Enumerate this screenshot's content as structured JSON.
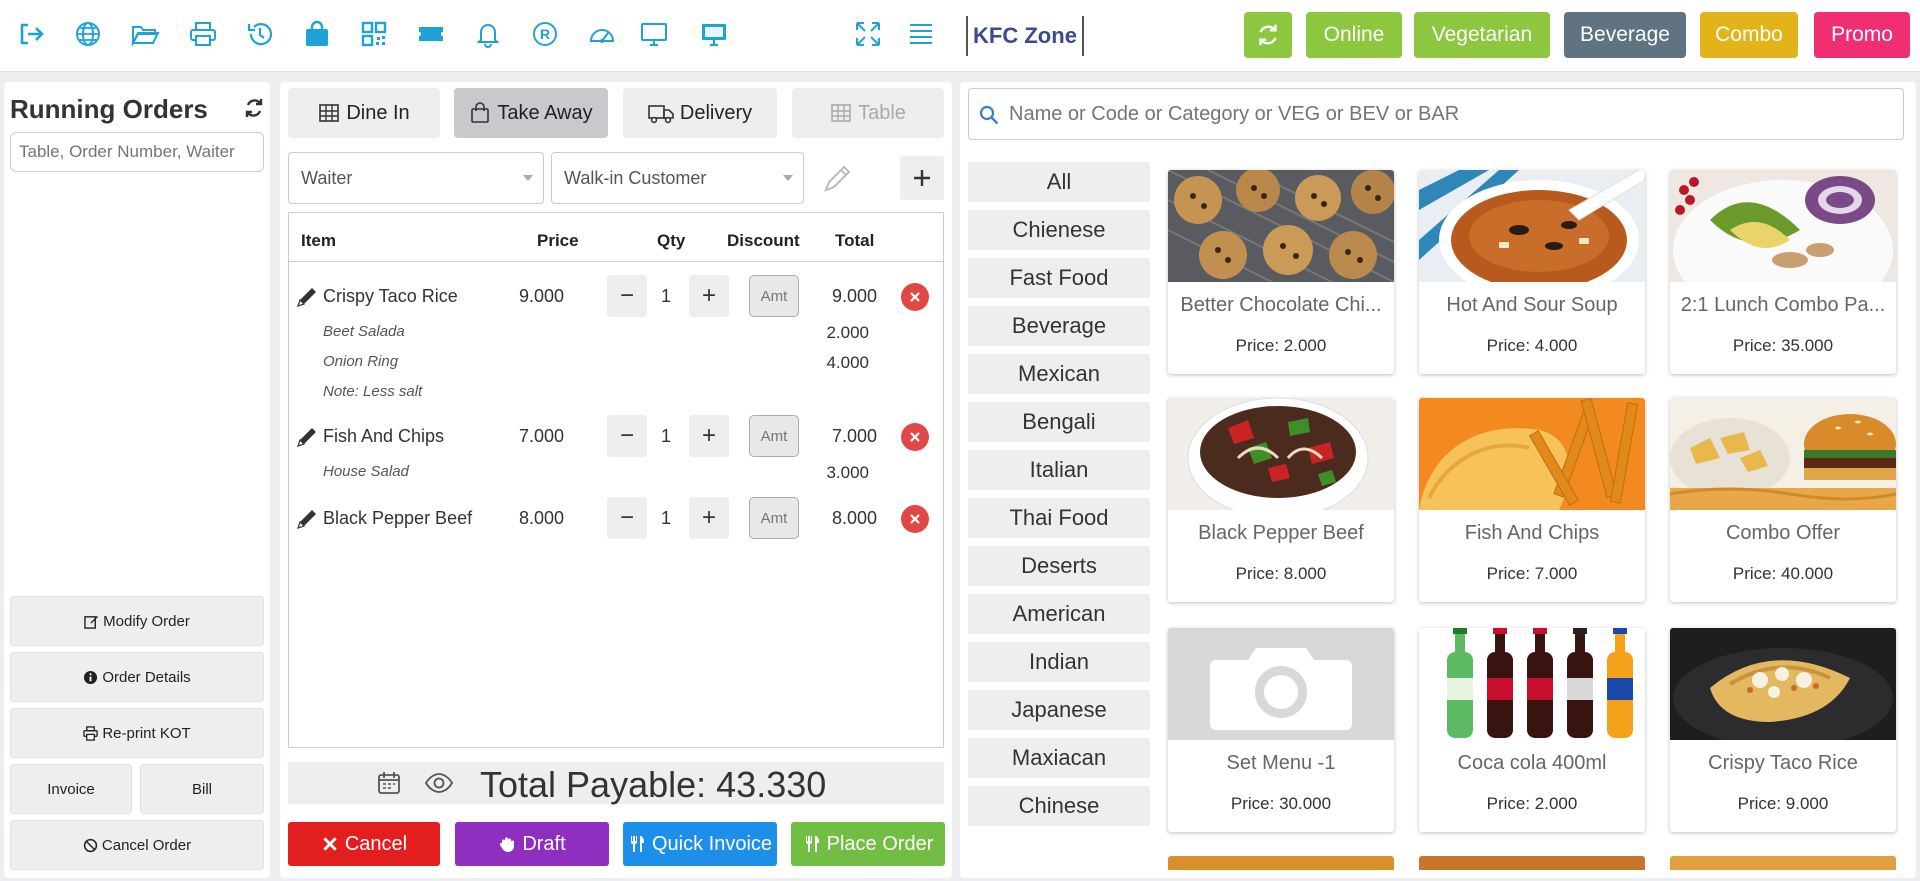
{
  "topbar": {
    "icons": [
      "logout-icon",
      "globe-icon",
      "folder-open-icon",
      "printer-icon",
      "history-icon",
      "shopping-bag-icon",
      "qr-code-icon",
      "ticket-icon",
      "bell-icon",
      "registered-icon",
      "dashboard-gauge-icon",
      "monitor-icon",
      "monitor-filled-icon",
      "expand-icon",
      "menu-lines-icon"
    ],
    "brand": "KFC Zone",
    "refresh_icon": "refresh-icon",
    "buttons": [
      {
        "label": "Online",
        "color": "#8dc63f"
      },
      {
        "label": "Vegetarian",
        "color": "#8dc63f"
      },
      {
        "label": "Beverage",
        "color": "#5f7480"
      },
      {
        "label": "Combo",
        "color": "#e2b41a"
      },
      {
        "label": "Promo",
        "color": "#ef2e73"
      }
    ]
  },
  "running_orders": {
    "title": "Running Orders",
    "search_placeholder": "Table, Order Number, Waiter",
    "buttons": {
      "modify": "Modify Order",
      "details": "Order Details",
      "reprint": "Re-print KOT",
      "invoice": "Invoice",
      "bill": "Bill",
      "cancel": "Cancel Order"
    }
  },
  "order": {
    "tabs": [
      {
        "label": "Dine In",
        "icon": "table-grid-icon",
        "state": "normal"
      },
      {
        "label": "Take Away",
        "icon": "shopping-bag-icon",
        "state": "active"
      },
      {
        "label": "Delivery",
        "icon": "truck-icon",
        "state": "normal"
      },
      {
        "label": "Table",
        "icon": "table-grid-icon",
        "state": "disabled"
      }
    ],
    "waiter": "Waiter",
    "customer": "Walk-in Customer",
    "headers": {
      "item": "Item",
      "price": "Price",
      "qty": "Qty",
      "discount": "Discount",
      "total": "Total"
    },
    "amt_placeholder": "Amt",
    "items": [
      {
        "name": "Crispy Taco Rice",
        "price": "9.000",
        "qty": "1",
        "total": "9.000",
        "modifiers": [
          {
            "text": "Beet   Salada",
            "price": "2.000"
          },
          {
            "text": "Onion   Ring",
            "price": "4.000"
          }
        ],
        "note": "Note: Less salt"
      },
      {
        "name": "Fish And Chips",
        "price": "7.000",
        "qty": "1",
        "total": "7.000",
        "modifiers": [
          {
            "text": "House   Salad",
            "price": "3.000"
          }
        ]
      },
      {
        "name": "Black Pepper Beef",
        "price": "8.000",
        "qty": "1",
        "total": "8.000",
        "modifiers": []
      }
    ],
    "total_payable": "Total Payable: 43.330",
    "actions": {
      "cancel": "Cancel",
      "draft": "Draft",
      "quick_invoice": "Quick Invoice",
      "place_order": "Place Order",
      "colors": {
        "cancel": "#e21e1e",
        "draft": "#8e2fbf",
        "quick_invoice": "#1e8fe8",
        "place_order": "#72bd43"
      }
    }
  },
  "products": {
    "search_placeholder": "Name or Code or Category or VEG or BEV or BAR",
    "categories": [
      "All",
      "Chienese",
      "Fast Food",
      "Beverage",
      "Mexican",
      "Bengali",
      "Italian",
      "Thai Food",
      "Deserts",
      "American",
      "Indian",
      "Japanese",
      "Maxiacan",
      "Chinese"
    ],
    "items": [
      {
        "name": "Better Chocolate Chi...",
        "price": "Price: 2.000",
        "image": "cookies"
      },
      {
        "name": "Hot And Sour Soup",
        "price": "Price: 4.000",
        "image": "soup"
      },
      {
        "name": "2:1 Lunch Combo Pa...",
        "price": "Price: 35.000",
        "image": "bowl"
      },
      {
        "name": "Black Pepper Beef",
        "price": "Price: 8.000",
        "image": "beef"
      },
      {
        "name": "Fish And Chips",
        "price": "Price: 7.000",
        "image": "fish"
      },
      {
        "name": "Combo Offer",
        "price": "Price: 40.000",
        "image": "burger"
      },
      {
        "name": "Set Menu -1",
        "price": "Price: 30.000",
        "image": "camera-placeholder"
      },
      {
        "name": "Coca cola 400ml",
        "price": "Price: 2.000",
        "image": "bottles"
      },
      {
        "name": "Crispy Taco Rice",
        "price": "Price: 9.000",
        "image": "taco"
      }
    ]
  }
}
